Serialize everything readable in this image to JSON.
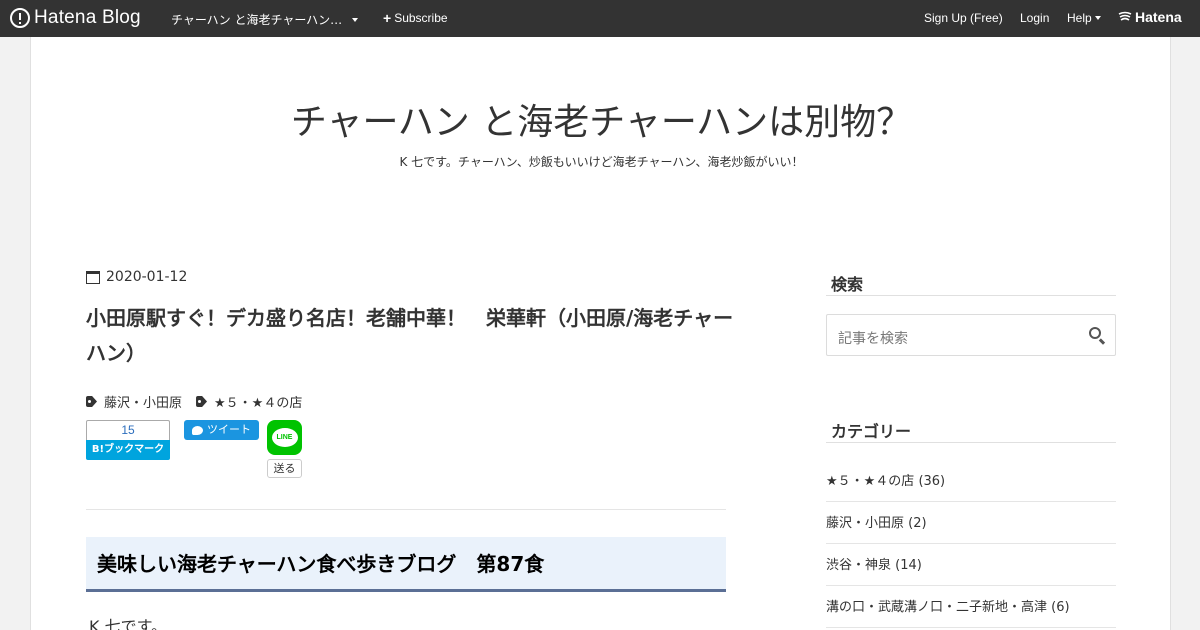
{
  "topbar": {
    "logo_text": "Hatena Blog",
    "blog_name": "チャーハン と海老チャーハン…",
    "subscribe_label": "Subscribe",
    "signup_label": "Sign Up (Free)",
    "login_label": "Login",
    "help_label": "Help",
    "brand_label": "Hatena"
  },
  "header": {
    "title": "チャーハン と海老チャーハンは別物？",
    "description": "K 七です。チャーハン、炒飯もいいけど海老チャーハン、海老炒飯がいい！"
  },
  "article": {
    "date": "2020-01-12",
    "title": "小田原駅すぐ！デカ盛り名店！老舗中華！　栄華軒（小田原/海老チャーハン）",
    "categories": [
      "藤沢・小田原",
      "★５・★４の店"
    ],
    "share": {
      "bookmark_count": "15",
      "bookmark_label": "B!ブックマーク",
      "tweet_label": "ツイート",
      "line_icon_text": "LINE",
      "line_send_label": "送る"
    },
    "section_heading": "美味しい海老チャーハン食べ歩きブログ　第87食",
    "body_first_line": "K 七です。"
  },
  "sidebar": {
    "search_title": "検索",
    "search_placeholder": "記事を検索",
    "categories_title": "カテゴリー",
    "categories": [
      "★５・★４の店 (36)",
      "藤沢・小田原 (2)",
      "渋谷・神泉 (14)",
      "溝の口・武蔵溝ノ口・二子新地・高津 (6)"
    ]
  },
  "colors": {
    "topbar_bg": "#333333",
    "heading_bg": "#eaf2fb",
    "heading_border": "#5b6f95",
    "bookmark_blue": "#00a4de",
    "twitter_blue": "#1b95e0",
    "line_green": "#00c300"
  }
}
